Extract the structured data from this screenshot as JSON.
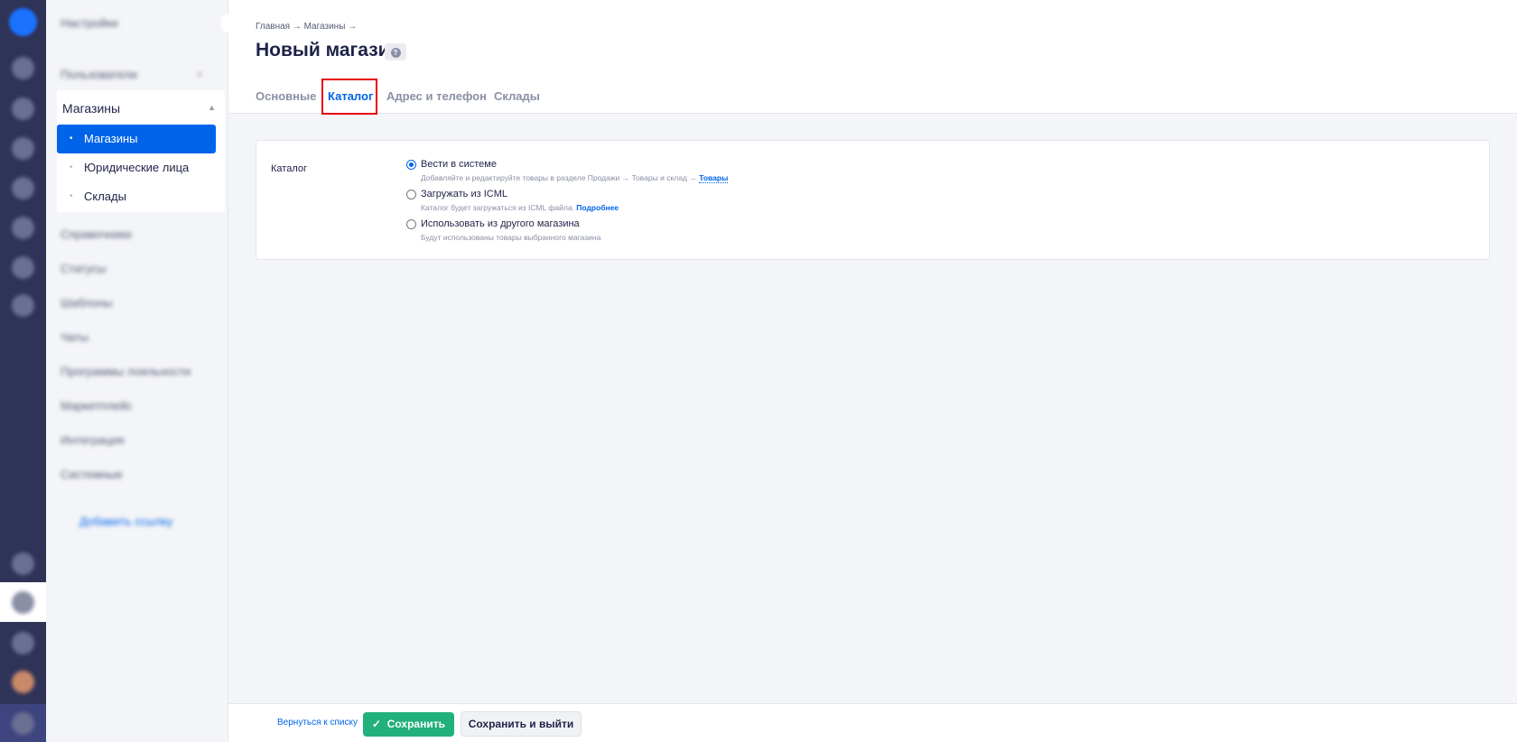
{
  "rail": {
    "icons": [
      "logo-icon",
      "cart-icon",
      "box-icon",
      "chat-icon",
      "chart-icon",
      "clock-icon",
      "search-people-icon",
      "printer-icon",
      "bell-icon",
      "settings-icon",
      "help-icon",
      "avatar",
      "support-icon"
    ]
  },
  "settings": {
    "title": "Настройки",
    "items_before": [
      {
        "label": "Пользователи"
      }
    ],
    "group": {
      "label": "Магазины",
      "children": [
        {
          "label": "Магазины",
          "active": true
        },
        {
          "label": "Юридические лица"
        },
        {
          "label": "Склады"
        }
      ]
    },
    "items_after": [
      {
        "label": "Справочники"
      },
      {
        "label": "Статусы"
      },
      {
        "label": "Шаблоны"
      },
      {
        "label": "Чаты"
      },
      {
        "label": "Программы лояльности"
      },
      {
        "label": "Маркетплейс"
      },
      {
        "label": "Интеграция"
      },
      {
        "label": "Системные"
      }
    ],
    "add_link": "Добавить ссылку"
  },
  "header": {
    "breadcrumb": "Главная → Магазины →",
    "title": "Новый магазин",
    "help": "?"
  },
  "tabs": [
    {
      "label": "Основные"
    },
    {
      "label": "Каталог",
      "active": true
    },
    {
      "label": "Адрес и телефон"
    },
    {
      "label": "Склады"
    }
  ],
  "catalog": {
    "label": "Каталог",
    "options": [
      {
        "label": "Вести в системе",
        "desc": "Добавляйте и редактируйте товары в разделе Продажи → Товары и склад →",
        "link": "Товары",
        "selected": true
      },
      {
        "label": "Загружать из ICML",
        "desc": "Каталог будет загружаться из ICML файла.",
        "link": "Подробнее",
        "selected": false
      },
      {
        "label": "Использовать из другого магазина",
        "desc": "Будут использованы товары выбранного магазина",
        "selected": false
      }
    ]
  },
  "footer": {
    "back": "Вернуться к списку",
    "save": "Сохранить",
    "save_exit": "Сохранить и выйти"
  },
  "colors": {
    "accent": "#0064ea",
    "save": "#22b07d",
    "rail": "#2f3358",
    "highlight": "#e8000b"
  }
}
